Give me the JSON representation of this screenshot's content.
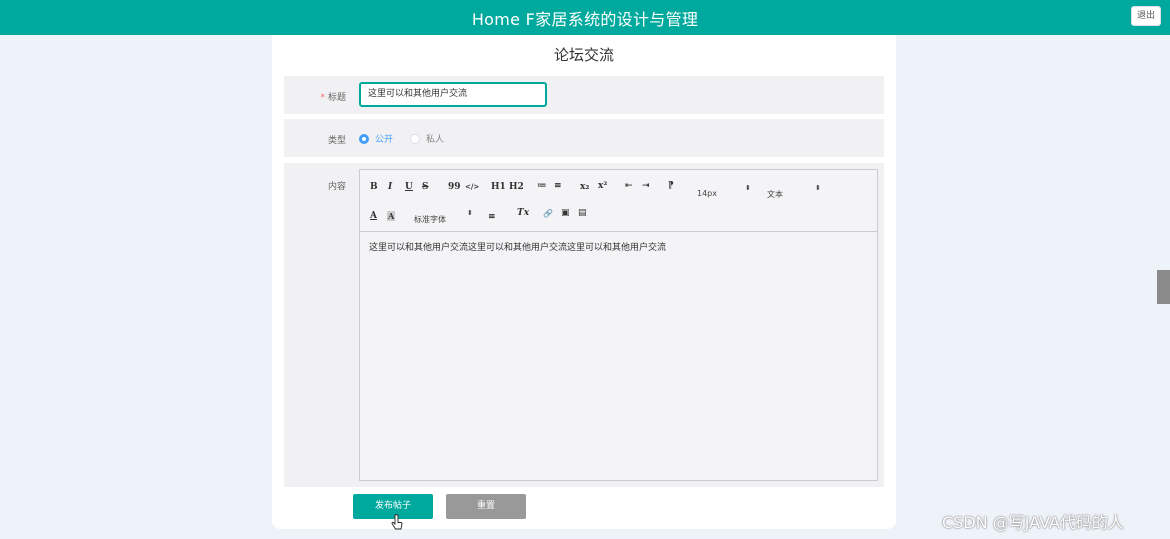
{
  "header": {
    "title": "Home F家居系统的设计与管理",
    "logout_label": "退出"
  },
  "page": {
    "title": "论坛交流"
  },
  "form": {
    "title_field": {
      "required_mark": "*",
      "label": "标题",
      "value": "这里可以和其他用户交流"
    },
    "type_field": {
      "label": "类型",
      "options": [
        {
          "label": "公开",
          "selected": true
        },
        {
          "label": "私人",
          "selected": false
        }
      ]
    },
    "content_field": {
      "label": "内容",
      "toolbar": {
        "bold": "B",
        "italic": "I",
        "underline": "U",
        "strike": "S",
        "quote": "99",
        "code": "</>",
        "h1": "H1",
        "h2": "H2",
        "ordered_list": "≔",
        "bullet_list": "≡",
        "subscript": "x₂",
        "superscript": "x²",
        "outdent": "⇤",
        "indent": "⇥",
        "direction": "⁋",
        "size_select": "14px",
        "header_select": "文本",
        "font_select": "标准字体",
        "font_color": "A",
        "background": "A",
        "align": "≡",
        "clean": "Tx",
        "link": "🔗",
        "image": "▣",
        "video": "▤"
      },
      "value": "这里可以和其他用户交流这里可以和其他用户交流这里可以和其他用户交流"
    }
  },
  "actions": {
    "submit_label": "发布帖子",
    "reset_label": "重置"
  },
  "watermark": "CSDN @写JAVA代码的人",
  "colors": {
    "primary": "#00a99d",
    "radio": "#409eff",
    "reset": "#999999"
  }
}
